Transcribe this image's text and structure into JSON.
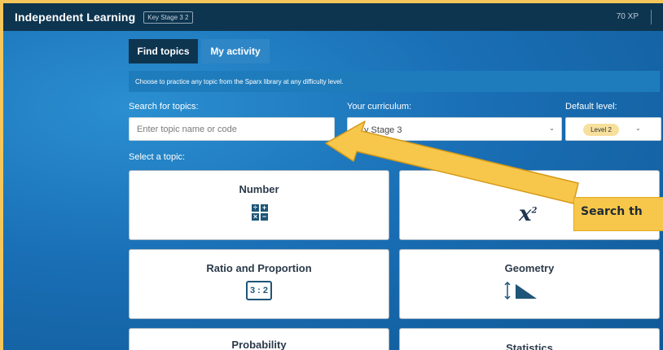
{
  "topbar": {
    "brand": "Independent Learning",
    "stage_badge": "Key Stage 3 2",
    "xp": "70 XP"
  },
  "tabs": [
    {
      "label": "Find topics"
    },
    {
      "label": "My activity"
    }
  ],
  "info": {
    "text": "Choose to practice any topic from the Sparx library at any difficulty level."
  },
  "search": {
    "label": "Search for topics:",
    "placeholder": "Enter topic name or code"
  },
  "curriculum": {
    "label": "Your curriculum:",
    "value": "y Stage 3"
  },
  "level": {
    "label": "Default level:",
    "value": "Level 2"
  },
  "select_label": "Select a topic:",
  "topics": [
    {
      "name": "Number",
      "icon": "number-operations-icon",
      "ops": [
        "÷",
        "+",
        "×",
        "−"
      ]
    },
    {
      "name": "",
      "icon": "algebra-x-squared-icon",
      "symbol": "x",
      "sup": "2"
    },
    {
      "name": "Ratio and Proportion",
      "icon": "ratio-icon",
      "symbol": "3 : 2"
    },
    {
      "name": "Geometry",
      "icon": "geometry-icon"
    },
    {
      "name": "Probability",
      "icon": ""
    },
    {
      "name": "Statistics",
      "icon": ""
    }
  ],
  "callout": {
    "text": "Search th"
  },
  "colors": {
    "topbar": "#0e3550",
    "accent": "#2e86c6",
    "highlight": "#f7c74b",
    "frame": "#f5c65a"
  }
}
